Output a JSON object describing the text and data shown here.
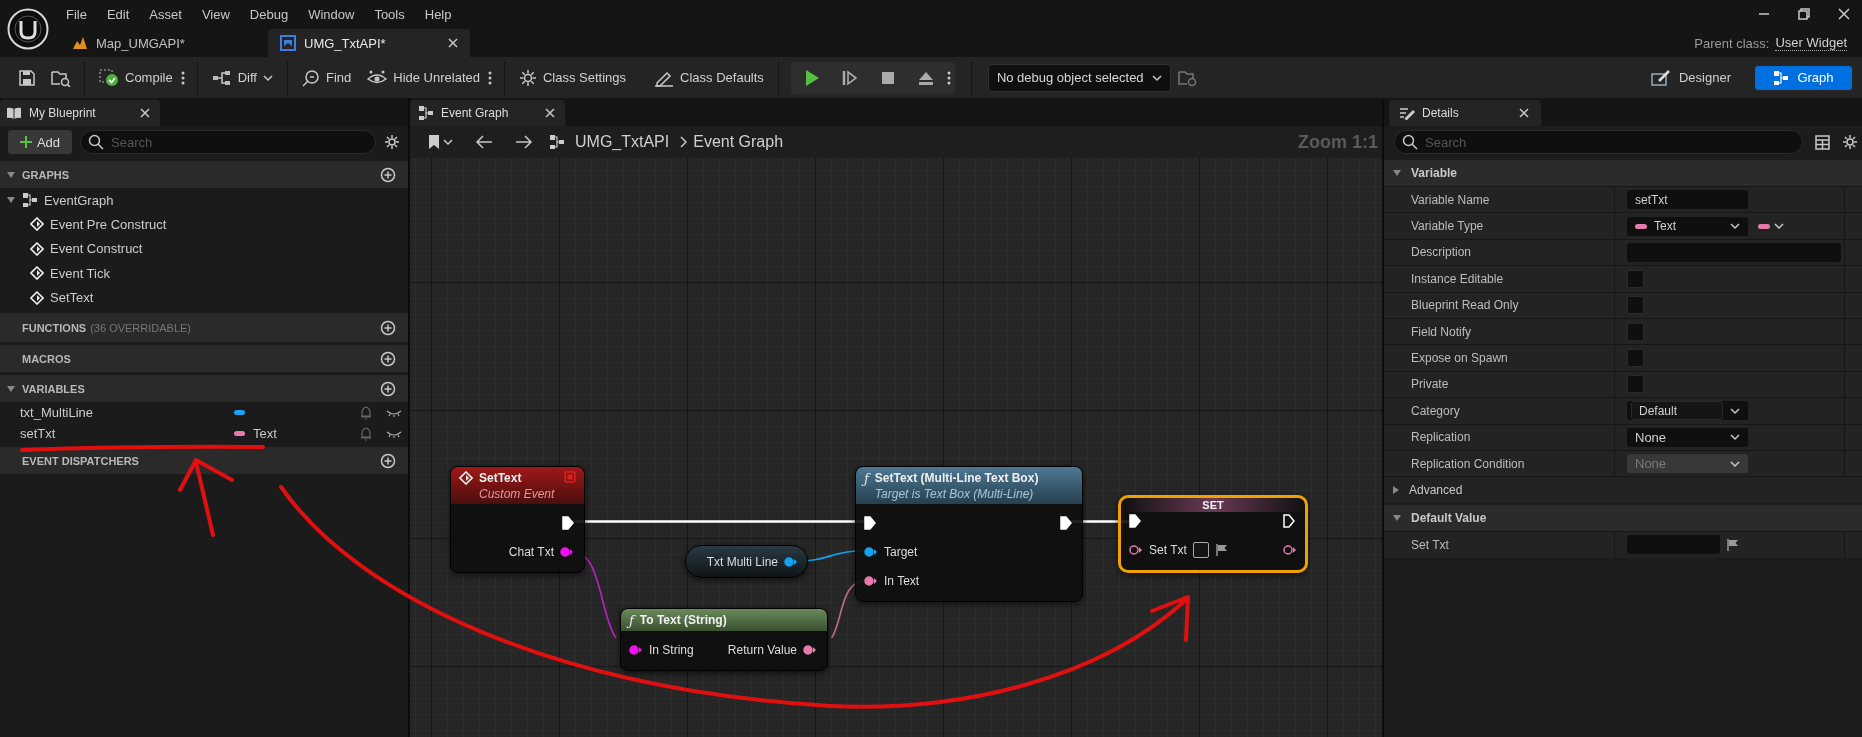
{
  "menu": [
    "File",
    "Edit",
    "Asset",
    "View",
    "Debug",
    "Window",
    "Tools",
    "Help"
  ],
  "tabs": [
    {
      "label": "Map_UMGAPI*",
      "selected": false
    },
    {
      "label": "UMG_TxtAPI*",
      "selected": true
    }
  ],
  "parent_class": {
    "label": "Parent class:",
    "value": "User Widget"
  },
  "toolbar": {
    "buttons": [
      "Compile",
      "Diff",
      "Find",
      "Hide Unrelated",
      "Class Settings",
      "Class Defaults"
    ],
    "debug_object": "No debug object selected",
    "modes": [
      {
        "label": "Designer",
        "selected": false
      },
      {
        "label": "Graph",
        "selected": true
      }
    ]
  },
  "my_blueprint": {
    "tab": "My Blueprint",
    "add_button": "Add",
    "search_placeholder": "Search",
    "sections": [
      {
        "title": "GRAPHS",
        "expanded": true,
        "items": [
          {
            "label": "EventGraph",
            "expanded": true,
            "children": [
              {
                "label": "Event Pre Construct"
              },
              {
                "label": "Event Construct"
              },
              {
                "label": "Event Tick"
              },
              {
                "label": "SetText"
              }
            ]
          }
        ]
      },
      {
        "title": "FUNCTIONS",
        "note": "(36 OVERRIDABLE)"
      },
      {
        "title": "MACROS"
      },
      {
        "title": "VARIABLES",
        "expanded": true,
        "variables": [
          {
            "name": "txt_MultiLine",
            "color": "#1ba4f2"
          },
          {
            "name": "setTxt",
            "type": "Text",
            "color": "#e57aab"
          }
        ]
      },
      {
        "title": "EVENT DISPATCHERS"
      }
    ]
  },
  "graph": {
    "tab": "Event Graph",
    "breadcrumb": [
      "UMG_TxtAPI",
      "Event Graph"
    ],
    "zoom": "Zoom 1:1",
    "nodes": [
      {
        "kind": "event",
        "title": "SetText",
        "subtitle": "Custom Event",
        "outputs": [
          {
            "label": "Chat Txt",
            "color": "#f012f0"
          }
        ]
      },
      {
        "kind": "function",
        "icon": "ƒ",
        "title": "SetText (Multi-Line Text Box)",
        "subtitle": "Target is Text Box (Multi-Line)",
        "inputs": [
          {
            "label": "Target",
            "color": "#15a2f0"
          },
          {
            "label": "In Text",
            "color": "#e57aab"
          }
        ]
      },
      {
        "kind": "set",
        "title": "SET",
        "selected": true,
        "inputs": [
          {
            "label": "Set Txt",
            "color": "#e57aab"
          }
        ]
      },
      {
        "kind": "getter",
        "label": "Txt Multi Line",
        "color": "#15a2f0"
      },
      {
        "kind": "pure",
        "icon": "ƒ",
        "title": "To Text (String)",
        "inputs": [
          {
            "label": "In String",
            "color": "#f012f0"
          }
        ],
        "outputs": [
          {
            "label": "Return Value",
            "color": "#e57aab"
          }
        ]
      }
    ]
  },
  "details": {
    "tab": "Details",
    "search_placeholder": "Search",
    "sections": [
      {
        "kind": "category",
        "title": "Variable",
        "expanded": true,
        "rows": [
          {
            "kind": "text",
            "label": "Variable Name",
            "value": "setTxt"
          },
          {
            "kind": "type",
            "label": "Variable Type",
            "value": "Text",
            "color": "#e57aab"
          },
          {
            "kind": "textarea",
            "label": "Description"
          },
          {
            "kind": "checkbox",
            "label": "Instance Editable",
            "checked": false
          },
          {
            "kind": "checkbox",
            "label": "Blueprint Read Only",
            "checked": false
          },
          {
            "kind": "checkbox",
            "label": "Field Notify",
            "checked": false
          },
          {
            "kind": "checkbox",
            "label": "Expose on Spawn",
            "checked": false
          },
          {
            "kind": "checkbox",
            "label": "Private",
            "checked": false
          },
          {
            "kind": "combo",
            "label": "Category",
            "value": "Default"
          },
          {
            "kind": "dropdown",
            "label": "Replication",
            "value": "None",
            "disabled": false
          },
          {
            "kind": "dropdown",
            "label": "Replication Condition",
            "value": "None",
            "disabled": true
          }
        ]
      },
      {
        "kind": "subcategory",
        "title": "Advanced",
        "expanded": false
      },
      {
        "kind": "category",
        "title": "Default Value",
        "expanded": true,
        "rows": [
          {
            "kind": "flag_text",
            "label": "Set Txt"
          }
        ]
      }
    ]
  }
}
